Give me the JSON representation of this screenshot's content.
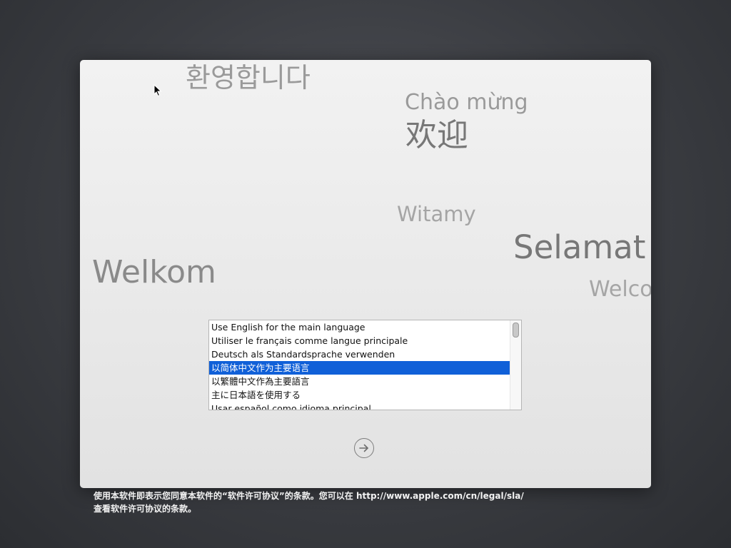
{
  "greetings": {
    "korean": "환영합니다",
    "vietnamese": "Chào mừng",
    "chinese": "欢迎",
    "polish": "Witamy",
    "indonesian": "Selamat Datang",
    "dutch": "Welkom",
    "english": "Welcome"
  },
  "language_list": {
    "items": [
      "Use English for the main language",
      "Utiliser le français comme langue principale",
      "Deutsch als Standardsprache verwenden",
      "以简体中文作为主要语言",
      "以繁體中文作為主要語言",
      "主に日本語を使用する",
      "Usar español como idioma principal"
    ],
    "selected_index": 3,
    "selected_color": "#1060d8"
  },
  "continue_button": {
    "icon": "arrow-right-circle-icon"
  },
  "legal": {
    "line1": "使用本软件即表示您同意本软件的“软件许可协议”的条款。您可以在 http://www.apple.com/cn/legal/sla/",
    "line2": "查看软件许可协议的条款。"
  }
}
